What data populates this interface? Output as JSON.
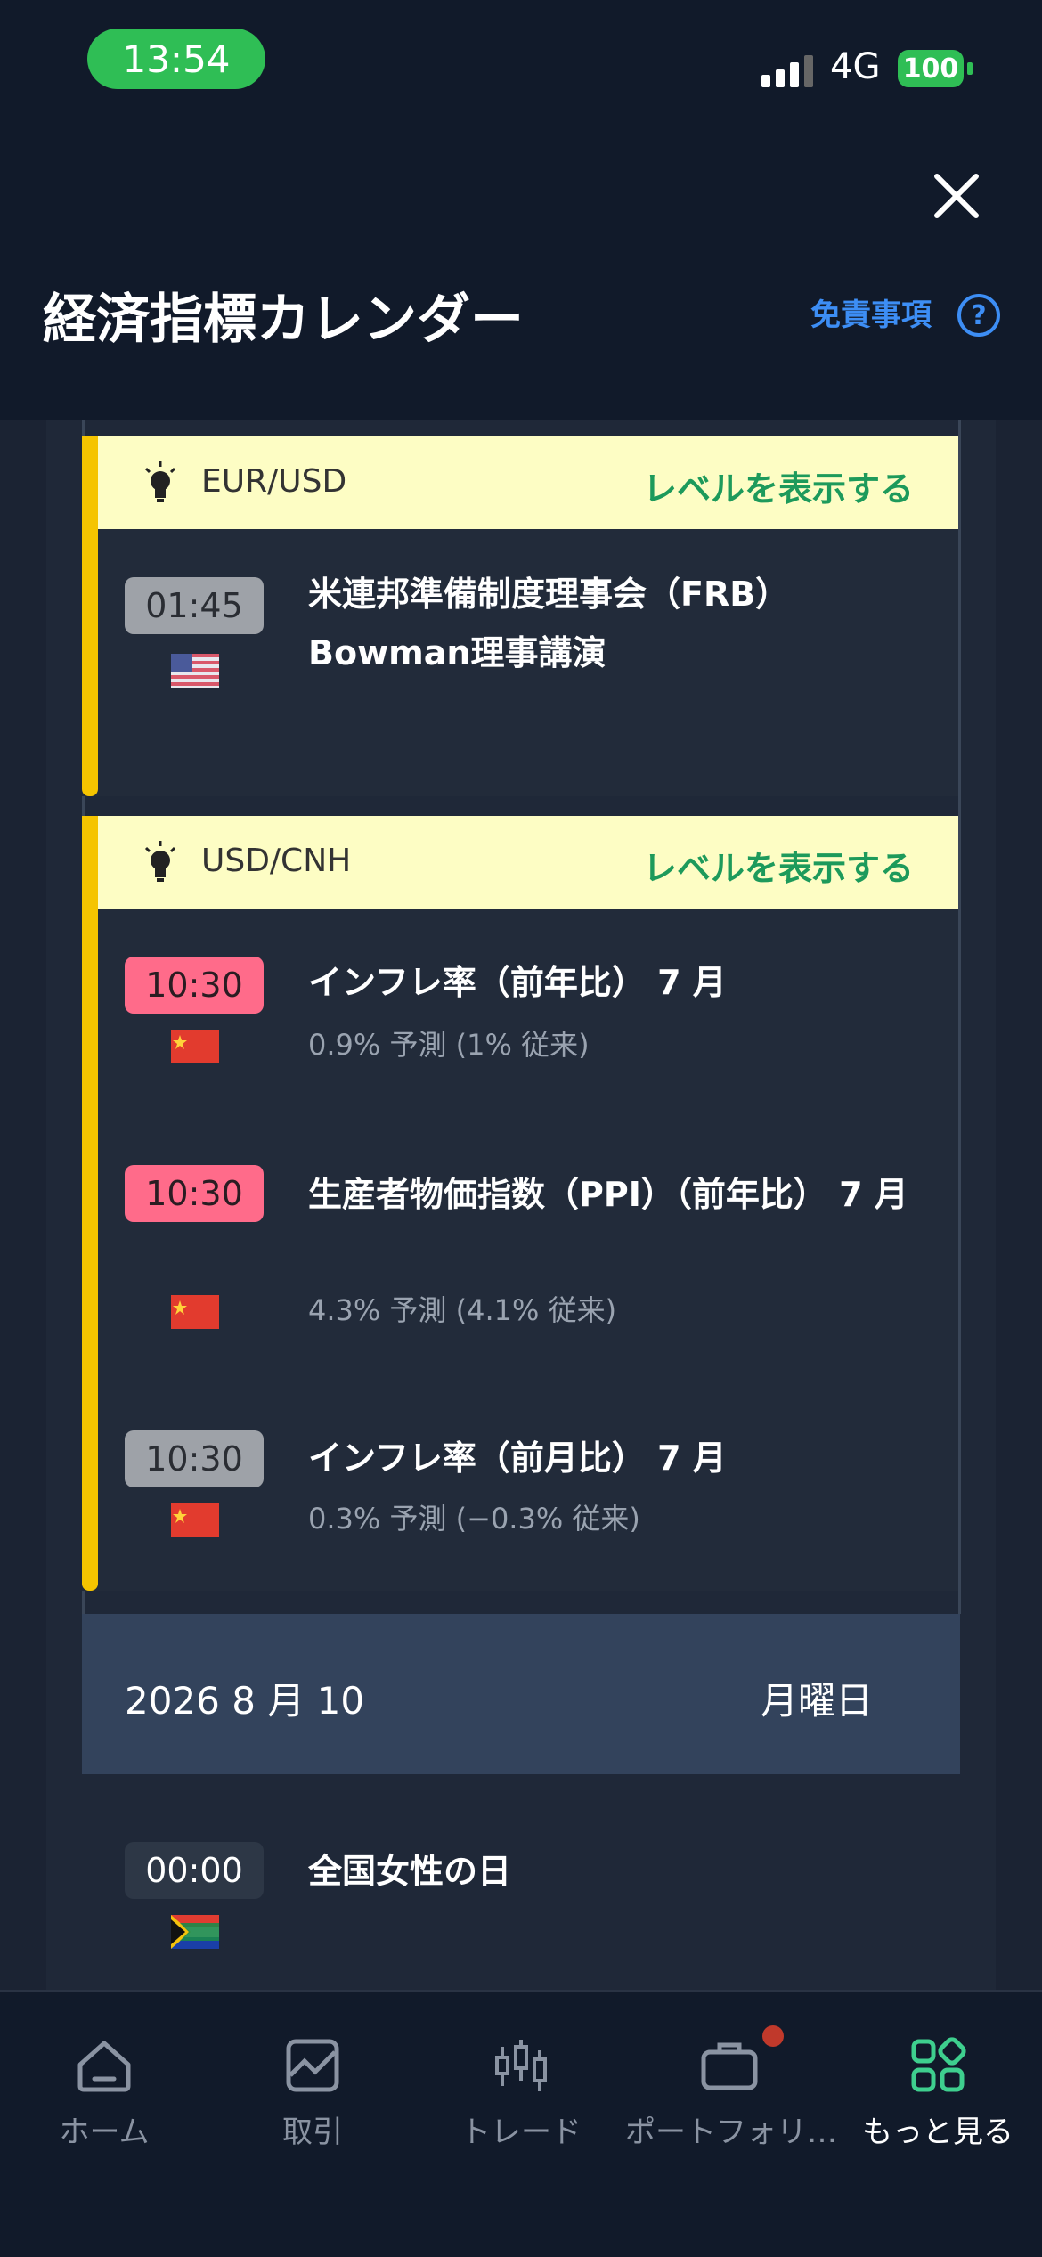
{
  "status_bar": {
    "time": "13:54",
    "network": "4G",
    "battery": "100"
  },
  "header": {
    "title": "経済指標カレンダー",
    "disclaimer": "免責事項",
    "help": "?"
  },
  "groups": [
    {
      "pair": "EUR/USD",
      "level_button": "レベルを表示する",
      "events": [
        {
          "time": "01:45",
          "style": "gray",
          "country": "US",
          "title": "米連邦準備制度理事会（FRB） Bowman理事講演",
          "detail": ""
        }
      ]
    },
    {
      "pair": "USD/CNH",
      "level_button": "レベルを表示する",
      "events": [
        {
          "time": "10:30",
          "style": "red",
          "country": "CN",
          "title": "インフレ率（前年比） 7 月",
          "detail": "0.9% 予測 (1% 従来)"
        },
        {
          "time": "10:30",
          "style": "red",
          "country": "CN",
          "title": "生産者物価指数（PPI）（前年比） 7 月",
          "detail": "4.3% 予測 (4.1% 従来)"
        },
        {
          "time": "10:30",
          "style": "gray",
          "country": "CN",
          "title": "インフレ率（前月比） 7 月",
          "detail": "0.3% 予測 (−0.3% 従来)"
        }
      ]
    }
  ],
  "date_header": {
    "date": "2026 8 月 10",
    "weekday": "月曜日"
  },
  "next_event": {
    "time": "00:00",
    "style": "dark",
    "country": "ZA",
    "title": "全国女性の日"
  },
  "nav": [
    {
      "label": "ホーム",
      "icon": "home-icon",
      "active": false
    },
    {
      "label": "取引",
      "icon": "chart-icon",
      "active": false
    },
    {
      "label": "トレード",
      "icon": "candles-icon",
      "active": false
    },
    {
      "label": "ポートフォリ…",
      "icon": "briefcase-icon",
      "active": false
    },
    {
      "label": "もっと見る",
      "icon": "grid-icon",
      "active": true
    }
  ],
  "colors": {
    "accent_yellow": "#f5c400",
    "level_green": "#1d9a5b",
    "link_blue": "#3d8ef5",
    "active_tab": "#3ecf8e"
  }
}
